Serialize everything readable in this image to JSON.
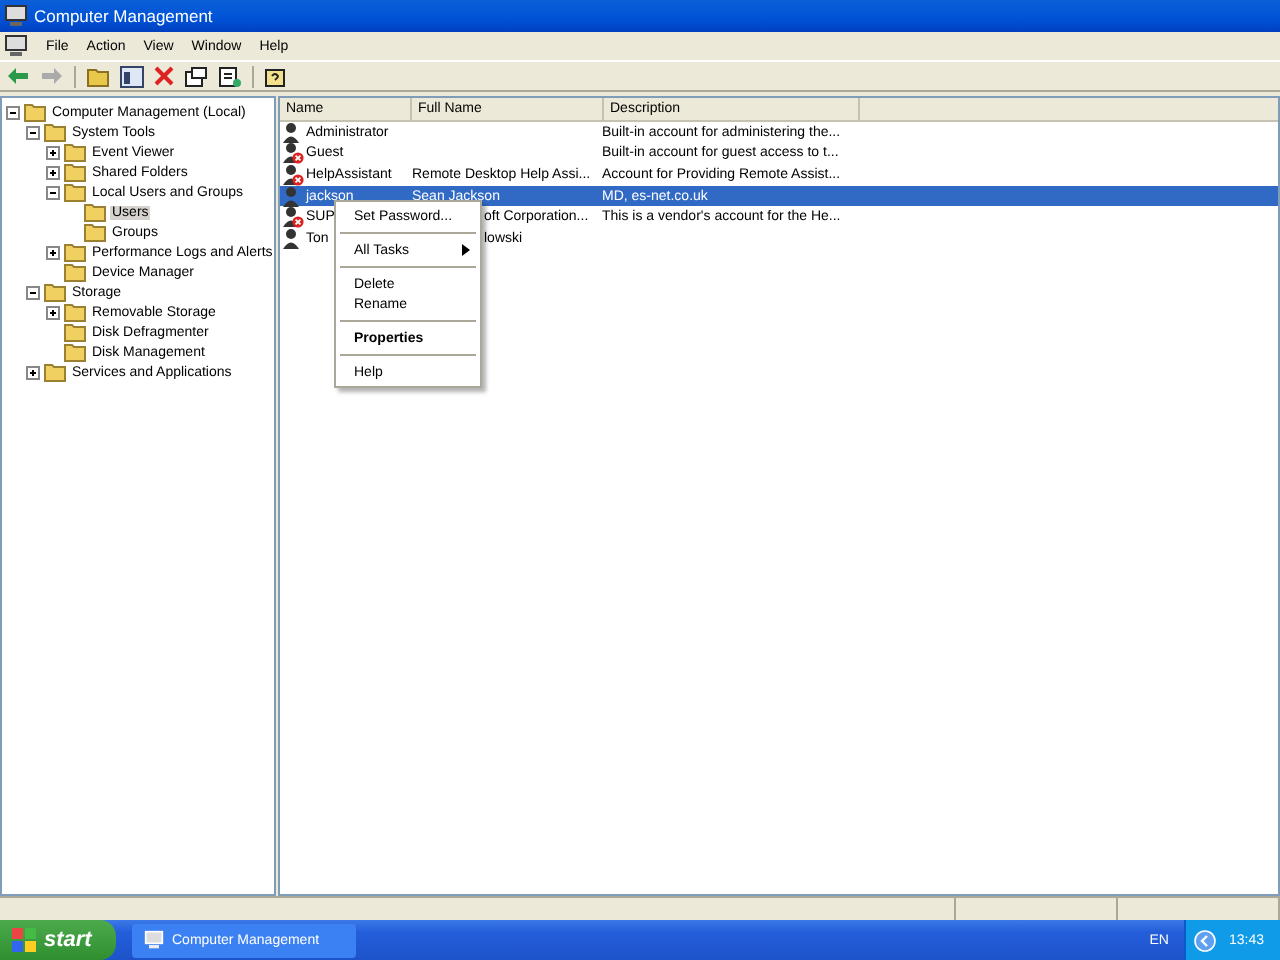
{
  "window": {
    "title": "Computer Management"
  },
  "menu": [
    "File",
    "Action",
    "View",
    "Window",
    "Help"
  ],
  "tree": [
    {
      "label": "Computer Management (Local)",
      "expanded": true,
      "selected": false,
      "children": [
        {
          "label": "System Tools",
          "expanded": true,
          "selected": false,
          "children": [
            {
              "label": "Event Viewer",
              "expanded": false,
              "selected": false
            },
            {
              "label": "Shared Folders",
              "expanded": false,
              "selected": false
            },
            {
              "label": "Local Users and Groups",
              "expanded": true,
              "selected": false,
              "children": [
                {
                  "label": "Users",
                  "selected": true
                },
                {
                  "label": "Groups",
                  "selected": false
                }
              ]
            },
            {
              "label": "Performance Logs and Alerts",
              "expanded": false,
              "selected": false
            },
            {
              "label": "Device Manager",
              "selected": false
            }
          ]
        },
        {
          "label": "Storage",
          "expanded": true,
          "selected": false,
          "children": [
            {
              "label": "Removable Storage",
              "expanded": false,
              "selected": false
            },
            {
              "label": "Disk Defragmenter",
              "selected": false
            },
            {
              "label": "Disk Management",
              "selected": false
            }
          ]
        },
        {
          "label": "Services and Applications",
          "expanded": false,
          "selected": false
        }
      ]
    }
  ],
  "table": {
    "columns": [
      "Name",
      "Full Name",
      "Description"
    ],
    "rows": [
      {
        "name": "Administrator",
        "full_name": "",
        "description": "Built-in account for administering the...",
        "disabled": false,
        "selected": false
      },
      {
        "name": "Guest",
        "full_name": "",
        "description": "Built-in account for guest access to t...",
        "disabled": true,
        "selected": false
      },
      {
        "name": "HelpAssistant",
        "full_name": "Remote Desktop Help Assi...",
        "description": "Account for Providing Remote Assist...",
        "disabled": true,
        "selected": false
      },
      {
        "name": "jackson",
        "full_name": "Sean Jackson",
        "description": "MD, es-net.co.uk",
        "disabled": false,
        "selected": true
      },
      {
        "name": "SUP",
        "full_name": "oft Corporation...",
        "description": "This is a vendor's account for the He...",
        "disabled": true,
        "selected": false
      },
      {
        "name": "Ton",
        "full_name": "lowski",
        "description": "",
        "disabled": false,
        "selected": false
      }
    ]
  },
  "context_menu": [
    {
      "kind": "item",
      "label": "Set Password...",
      "default": false,
      "submenu": false
    },
    {
      "kind": "separator"
    },
    {
      "kind": "item",
      "label": "All Tasks",
      "default": false,
      "submenu": true
    },
    {
      "kind": "separator"
    },
    {
      "kind": "item",
      "label": "Delete",
      "default": false,
      "submenu": false
    },
    {
      "kind": "item",
      "label": "Rename",
      "default": false,
      "submenu": false
    },
    {
      "kind": "separator"
    },
    {
      "kind": "item",
      "label": "Properties",
      "default": true,
      "submenu": false
    },
    {
      "kind": "separator"
    },
    {
      "kind": "item",
      "label": "Help",
      "default": false,
      "submenu": false
    }
  ],
  "taskbar": {
    "start": "start",
    "tasks": [
      {
        "label": "Computer Management",
        "selected": false
      }
    ],
    "language": "EN",
    "clock": "13:43"
  }
}
